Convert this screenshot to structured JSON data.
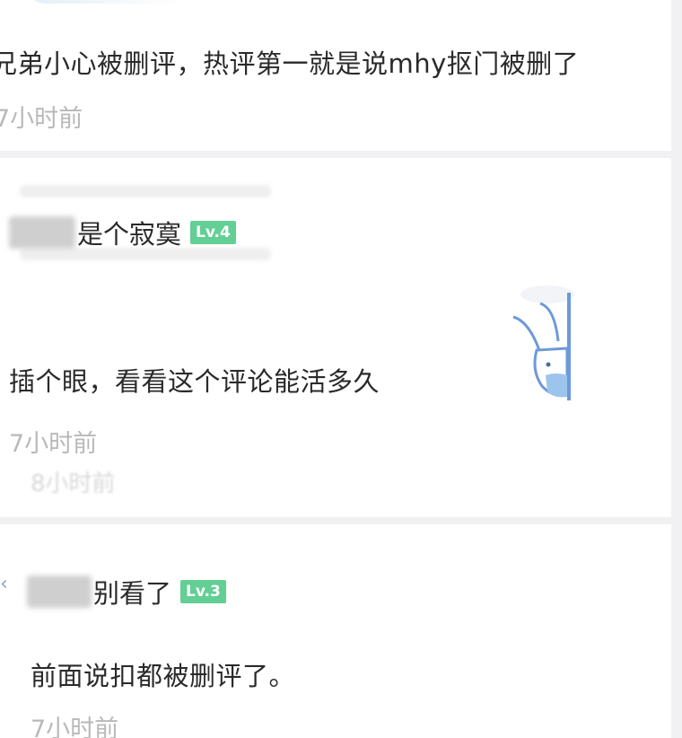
{
  "comments": [
    {
      "text": "兄弟小心被删评，热评第一就是说mhy抠门被删了",
      "time": "7小时前"
    },
    {
      "username_suffix": "是个寂寞",
      "level": "Lv.4",
      "text": "插个眼，看看这个评论能活多久",
      "time": "7小时前",
      "ghost_time": "8小时前",
      "sticker": "rabbit-peeking-sticker"
    },
    {
      "username_suffix": "别看了",
      "level": "Lv.3",
      "text": "前面说扣都被删评了。",
      "time": "7小时前"
    }
  ],
  "colors": {
    "level_badge": "#63cf94",
    "time_text": "#b9b9b9",
    "body_text": "#2a2a2a",
    "divider": "#f1f1f3"
  }
}
